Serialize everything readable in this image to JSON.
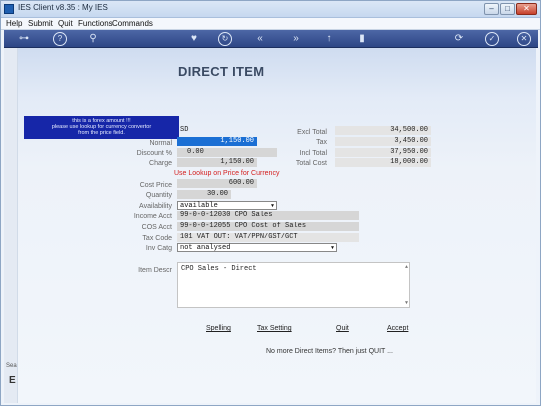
{
  "window": {
    "title": "IES Client v8.35 : My IES",
    "min": "–",
    "max": "□",
    "close": "✕"
  },
  "menu": [
    "Help",
    "Submit",
    "Quit",
    "Functions",
    "Commands"
  ],
  "toolbar": [
    "key-icon",
    "help-icon",
    "search-icon",
    "heart-icon",
    "refresh-icon",
    "rewind-icon",
    "forward-icon",
    "up-icon",
    "doc-icon",
    "sync-icon",
    "check-icon",
    "close-icon"
  ],
  "page": {
    "title": "DIRECT ITEM"
  },
  "tooltip": {
    "line1": "this is a forex amount !!!",
    "line2": "please use lookup for currency convertor",
    "line3": "from the price field."
  },
  "form": {
    "currency": "SD",
    "normal_label": "Normal",
    "normal_value": "1,150.00",
    "discount_label": "Discount %",
    "discount_value": "0.00",
    "charge_label": "Charge",
    "charge_value": "1,150.00",
    "hint": "Use Lookup on Price for Currency",
    "cost_price_label": "Cost Price",
    "cost_price_value": "600.00",
    "quantity_label": "Quantity",
    "quantity_value": "30.00",
    "availability_label": "Availability",
    "availability_value": "available",
    "income_acct_label": "Income Acct",
    "income_acct_value": "99-0-0-12030 CPO Sales",
    "cos_acct_label": "COS Acct",
    "cos_acct_value": "99-0-0-12055 CPO Cost of Sales",
    "tax_code_label": "Tax Code",
    "tax_code_value": "101 VAT OUT: VAT/PPN/GST/GCT",
    "inv_catg_label": "Inv Catg",
    "inv_catg_value": "not analysed",
    "item_descr_label": "Item Descr",
    "item_descr_value": "CPO Sales - Direct"
  },
  "totals": {
    "excl_label": "Excl Total",
    "excl_value": "34,500.00",
    "tax_label": "Tax",
    "tax_value": "3,450.00",
    "incl_label": "Incl Total",
    "incl_value": "37,950.00",
    "cost_label": "Total Cost",
    "cost_value": "18,000.00"
  },
  "actions": {
    "spelling": "Spelling",
    "tax_setting": "Tax Setting",
    "quit": "Quit",
    "accept": "Accept"
  },
  "footer": "No more Direct Items? Then just QUIT ...",
  "side": {
    "text": "Sea",
    "mark": "E"
  }
}
